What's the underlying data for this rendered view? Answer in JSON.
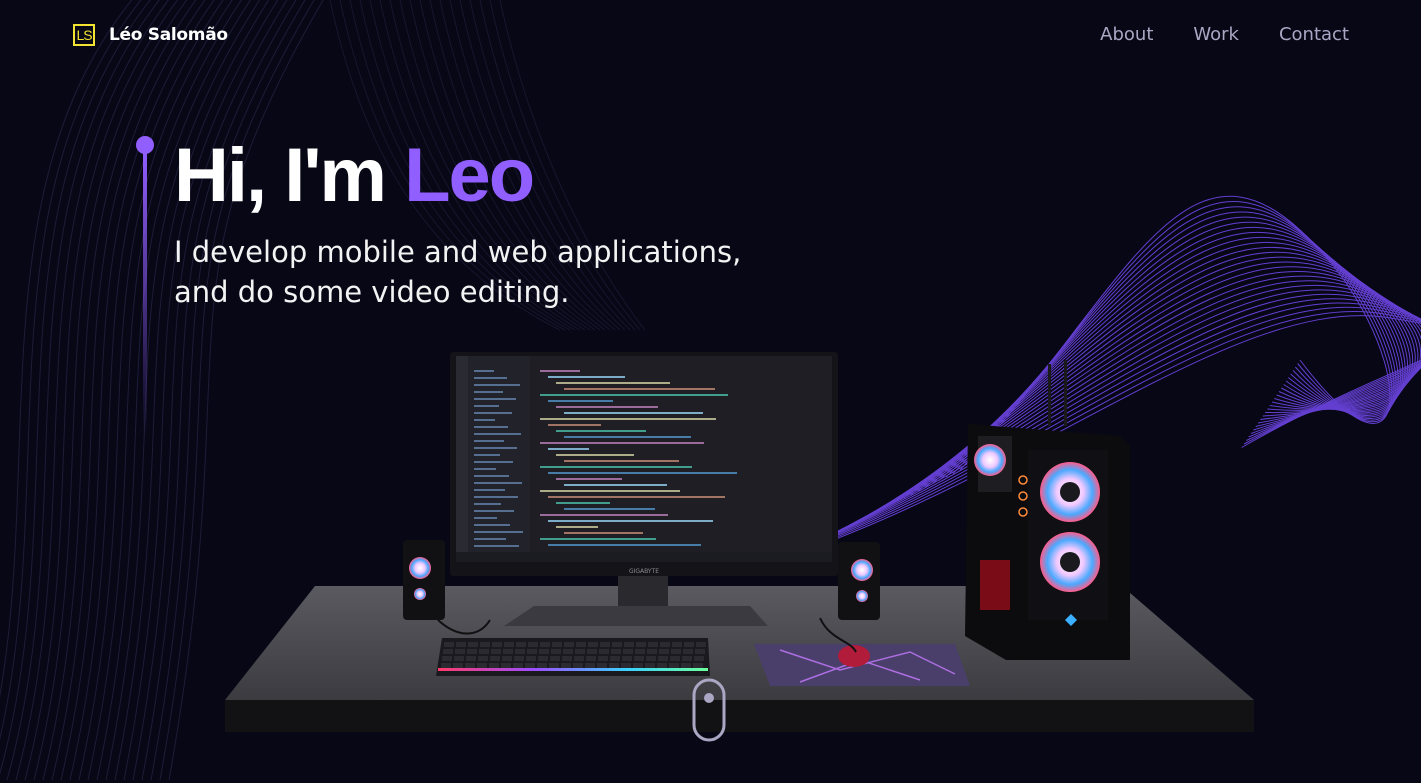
{
  "brand": {
    "initials": "LS",
    "name": "Léo Salomão"
  },
  "nav": [
    {
      "label": "About"
    },
    {
      "label": "Work"
    },
    {
      "label": "Contact"
    }
  ],
  "hero": {
    "greeting": "Hi, I'm ",
    "name": "Leo",
    "subtitle_line1": "I develop mobile and web applications,",
    "subtitle_line2": "and do some video editing."
  },
  "monitor": {
    "brand_label": "GIGABYTE"
  },
  "colors": {
    "accent": "#915eff",
    "logo": "#f3e331",
    "background": "#070716",
    "nav_text": "#aaa6c3"
  }
}
